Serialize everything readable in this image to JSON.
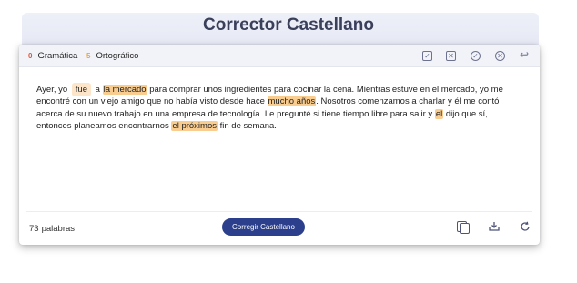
{
  "header": {
    "title": "Corrector Castellano"
  },
  "toolbar": {
    "tabs": [
      {
        "count": "0",
        "label": "Gramática"
      },
      {
        "count": "5",
        "label": "Ortográfico"
      }
    ],
    "icons": [
      "check-square-icon",
      "x-square-icon",
      "check-circle-icon",
      "x-circle-icon",
      "undo-icon"
    ]
  },
  "text": {
    "segments": [
      "Ayer, yo",
      "fue",
      "a",
      "la mercado",
      "para comprar unos ingredientes para cocinar la cena. Mientras estuve en el mercado, yo me encontré con un viejo amigo que no había visto desde hace",
      "mucho años",
      ". Nosotros comenzamos a charlar y él me contó acerca de su nuevo trabajo en una empresa de tecnología. Le pregunté si tiene tiempo libre para salir y",
      "el",
      "dijo que sí, entonces planeamos encontrarnos",
      "el próximos",
      "fin de semana."
    ]
  },
  "footer": {
    "word_count": "73",
    "word_label": "palabras",
    "button_label": "Corregir Castellano"
  },
  "colors": {
    "accent": "#2c3f8c",
    "highlight": "#f9cc8f",
    "grammar_count": "#e0553a",
    "spelling_count": "#e8a53a"
  }
}
